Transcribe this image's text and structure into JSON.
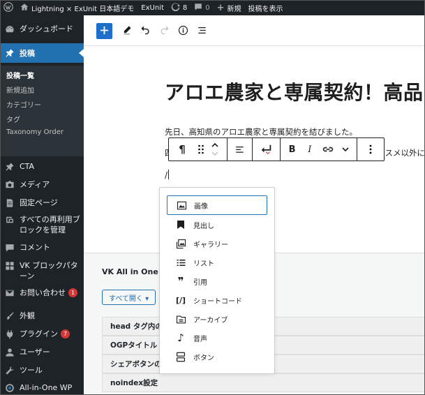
{
  "admin_bar": {
    "site_name": "Lightning × ExUnit 日本語デモ",
    "exunit": "ExUnit",
    "updates_count": "8",
    "comments_count": "0",
    "new_label": "新規",
    "view_post": "投稿を表示"
  },
  "sidebar": {
    "dashboard": "ダッシュボード",
    "posts": "投稿",
    "submenu": [
      "投稿一覧",
      "新規追加",
      "カテゴリー",
      "タグ",
      "Taxonomy Order"
    ],
    "cta": "CTA",
    "media": "メディア",
    "pages": "固定ページ",
    "reusable": "すべての再利用ブロックを管理",
    "comments": "コメント",
    "vk_block_patterns": "VK ブロックパターン",
    "contact": "お問い合わせ",
    "contact_badge": "1",
    "appearance": "外観",
    "plugins": "プラグイン",
    "plugins_badge": "7",
    "users": "ユーザー",
    "tools": "ツール",
    "aioseo": "All-in-One WP"
  },
  "editor": {
    "title": "アロエ農家と専属契約！高品",
    "paragraph1": "先日、高知県のアロエ農家と専属契約を結びました。",
    "paragraph2_start": "四",
    "paragraph2_end": "スメ以外に",
    "slash_text": "/"
  },
  "meta": {
    "box_title": "VK All in One E",
    "open_all": "すべて開く ▾",
    "rows": [
      "head タグ内の",
      "OGPタイトル",
      "シェアボタンの",
      "noindex設定"
    ]
  },
  "slash_menu": {
    "items": [
      {
        "label": "画像",
        "icon": "image-icon"
      },
      {
        "label": "見出し",
        "icon": "heading-bookmark-icon"
      },
      {
        "label": "ギャラリー",
        "icon": "gallery-icon"
      },
      {
        "label": "リスト",
        "icon": "list-icon"
      },
      {
        "label": "引用",
        "icon": "quote-icon"
      },
      {
        "label": "ショートコード",
        "icon": "shortcode-icon"
      },
      {
        "label": "アーカイブ",
        "icon": "archive-icon"
      },
      {
        "label": "音声",
        "icon": "audio-icon"
      },
      {
        "label": "ボタン",
        "icon": "buttons-icon"
      }
    ]
  },
  "colors": {
    "admin_dark": "#1d2327",
    "admin_blue": "#2271b1",
    "badge_red": "#d63638"
  }
}
